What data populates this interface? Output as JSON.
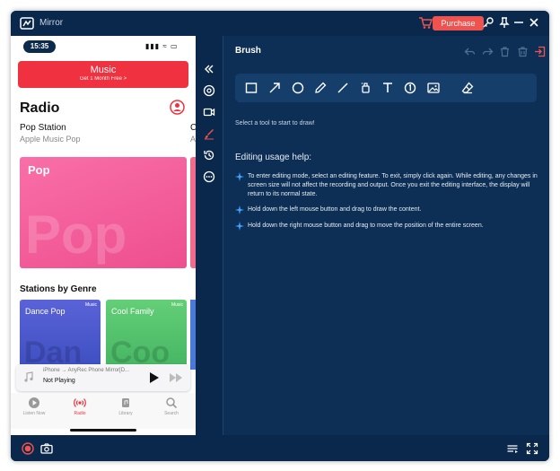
{
  "window": {
    "title": "Mirror"
  },
  "titlebar": {
    "purchase_label": "Purchase"
  },
  "phone": {
    "status_time": "15:35",
    "status_icons": "▮▮▮ ≈ ▭",
    "banner_title": " Music",
    "banner_subtitle": "Get 1 Month Free >",
    "page_title": "Radio",
    "station_name": "Pop Station",
    "station_sub": "Apple Music Pop",
    "station_next": "C",
    "station_next_sub": "A",
    "pop_card_title": "Pop",
    "pop_card_bg_text": "Pop",
    "genre_heading": "Stations by Genre",
    "genres": [
      {
        "title": "Dance Pop",
        "badge": "Music",
        "bg_text": "Dan",
        "color": "#4a5fd0"
      },
      {
        "title": "Cool Family",
        "badge": "Music",
        "bg_text": "Coo",
        "color": "#56c46e"
      }
    ],
    "mini_player": {
      "title": "iPhone → AnyRec Phone Mirror[D...",
      "status": "Not Playing"
    },
    "tabs": [
      {
        "label": "Listen Now",
        "active": false
      },
      {
        "label": "Radio",
        "active": true
      },
      {
        "label": "Library",
        "active": false
      },
      {
        "label": "Search",
        "active": false
      }
    ]
  },
  "panel": {
    "title": "Brush",
    "tool_hint": "Select a tool to start to draw!",
    "help_title": "Editing usage help:",
    "help_items": [
      "To enter editing mode, select an editing feature. To exit, simply click again. While editing, any changes in screen size will not affect the recording and output. Once you exit the editing interface, the display will return to its normal state.",
      "Hold down the left mouse button and drag to draw the content.",
      "Hold down the right mouse button and drag to move the position of the entire screen."
    ]
  },
  "colors": {
    "window_bg": "#0d2f55",
    "bar_bg": "#0a284b",
    "tool_row_bg": "#163e6b",
    "purchase": "#ef5350",
    "accent_red": "#f0313f",
    "pop_pink": "#f96fa8"
  }
}
